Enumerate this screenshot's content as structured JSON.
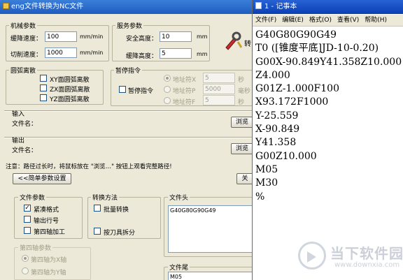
{
  "converter": {
    "title": "eng文件转换为NC文件",
    "machining_params": {
      "legend": "机械参数",
      "descent_speed_label": "缓降速度：",
      "descent_speed_value": "100",
      "descent_speed_unit": "mm/min",
      "cut_speed_label": "切削速度：",
      "cut_speed_value": "1000",
      "cut_speed_unit": "mm/min"
    },
    "service_params": {
      "legend": "服务参数",
      "safe_height_label": "安全高度：",
      "safe_height_value": "10",
      "safe_height_unit": "mm",
      "descent_height_label": "缓降高度：",
      "descent_height_value": "5",
      "descent_height_unit": "mm"
    },
    "convert_button_label": "转",
    "arc_dispersion": {
      "legend": "圆弧离散",
      "xy_label": "XY面圆弧离散",
      "zx_label": "ZX面圆弧离散",
      "yz_label": "YZ面圆弧离散"
    },
    "pause_instruction": {
      "legend": "暂停指令",
      "pause_label": "暂停指令",
      "address1_label": "地址符X",
      "address1_value": "5",
      "address1_unit": "秒",
      "address2_label": "地址符P",
      "address2_value": "5000",
      "address2_unit": "毫秒",
      "address3_label": "地址符F",
      "address3_value": "5",
      "address3_unit": "秒"
    },
    "input": {
      "legend": "输入",
      "filename_label": "文件名：",
      "browse_label": "浏览"
    },
    "output": {
      "legend": "输出",
      "filename_label": "文件名：",
      "browse_label": "浏览"
    },
    "note": "注意：路径过长时，将鼠标放在 \"浏览…\" 按钮上观看完整路径!",
    "simple_params_button": "<<简单参数设置",
    "close_button": "关",
    "file_params": {
      "legend": "文件参数",
      "compact_label": "紧凑格式",
      "compact_checked": true,
      "line_number_label": "输出行号",
      "fourth_axis_label": "第四轴加工"
    },
    "conversion_method": {
      "legend": "转换方法",
      "batch_label": "批量转换",
      "split_by_tool_label": "按刀具拆分"
    },
    "file_header": {
      "legend": "文件头",
      "content": "G40G80G90G49"
    },
    "fourth_axis_params": {
      "legend": "第四轴参数",
      "option1_label": "第四轴为X轴",
      "option2_label": "第四轴为Y轴"
    },
    "file_footer": {
      "legend": "文件尾",
      "content": "M05"
    }
  },
  "notepad": {
    "title": "1 - 记事本",
    "menu": [
      "文件(F)",
      "编辑(E)",
      "格式(O)",
      "查看(V)",
      "帮助(H)"
    ],
    "lines": [
      "G40G80G90G49",
      "T0 ([锥度平底]JD-10-0.20)",
      "G00X-90.849Y41.358Z10.000",
      "Z4.000",
      "G01Z-1.000F100",
      "X93.172F1000",
      "Y-25.559",
      "X-90.849",
      "Y41.358",
      "G00Z10.000",
      "M05",
      "M30",
      "%"
    ]
  },
  "watermark": {
    "name": "当下软件园",
    "url": "www.downxia.com",
    "accent_color": "#8d98ab"
  }
}
